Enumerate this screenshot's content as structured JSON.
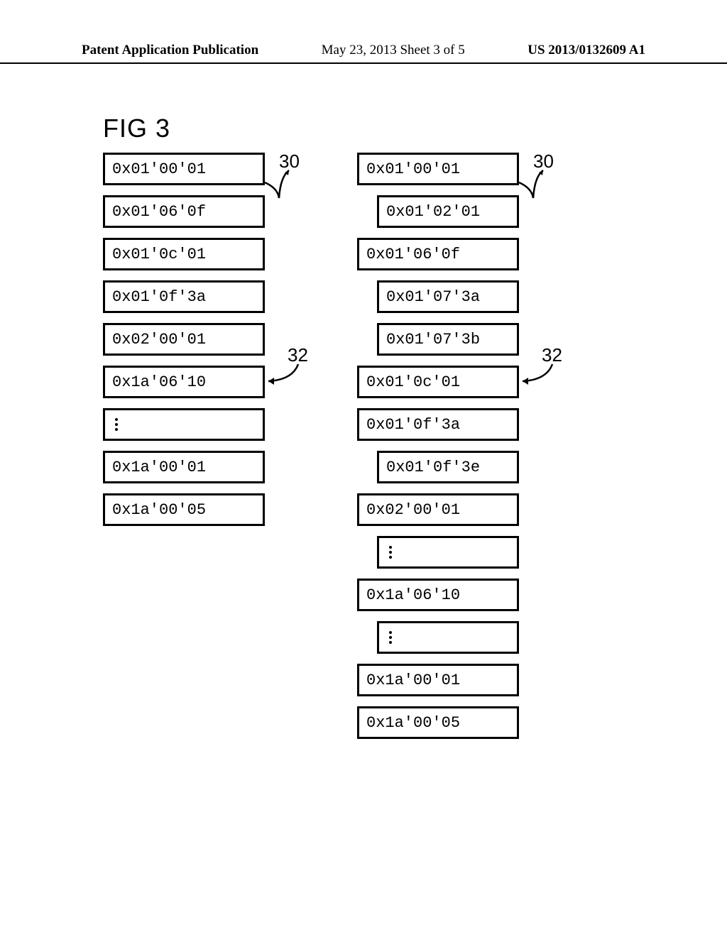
{
  "header": {
    "left": "Patent Application Publication",
    "mid": "May 23, 2013  Sheet 3 of 5",
    "right": "US 2013/0132609 A1"
  },
  "figure_title": "FIG  3",
  "labels": {
    "ref_30": "30",
    "ref_32": "32"
  },
  "left_column": [
    {
      "text": "0x01'00'01",
      "indent": false
    },
    {
      "text": "0x01'06'0f",
      "indent": false
    },
    {
      "text": "0x01'0c'01",
      "indent": false
    },
    {
      "text": "0x01'0f'3a",
      "indent": false
    },
    {
      "text": "0x02'00'01",
      "indent": false
    },
    {
      "text": "0x1a'06'10",
      "indent": false
    },
    {
      "text": "dots",
      "indent": false
    },
    {
      "text": "0x1a'00'01",
      "indent": false
    },
    {
      "text": "0x1a'00'05",
      "indent": false
    }
  ],
  "right_column": [
    {
      "text": "0x01'00'01",
      "indent": false
    },
    {
      "text": "0x01'02'01",
      "indent": true
    },
    {
      "text": "0x01'06'0f",
      "indent": false
    },
    {
      "text": "0x01'07'3a",
      "indent": true
    },
    {
      "text": "0x01'07'3b",
      "indent": true
    },
    {
      "text": "0x01'0c'01",
      "indent": false
    },
    {
      "text": "0x01'0f'3a",
      "indent": false
    },
    {
      "text": "0x01'0f'3e",
      "indent": true
    },
    {
      "text": "0x02'00'01",
      "indent": false
    },
    {
      "text": "dots",
      "indent": true
    },
    {
      "text": "0x1a'06'10",
      "indent": false
    },
    {
      "text": "dots",
      "indent": true
    },
    {
      "text": "0x1a'00'01",
      "indent": false
    },
    {
      "text": "0x1a'00'05",
      "indent": false
    }
  ]
}
